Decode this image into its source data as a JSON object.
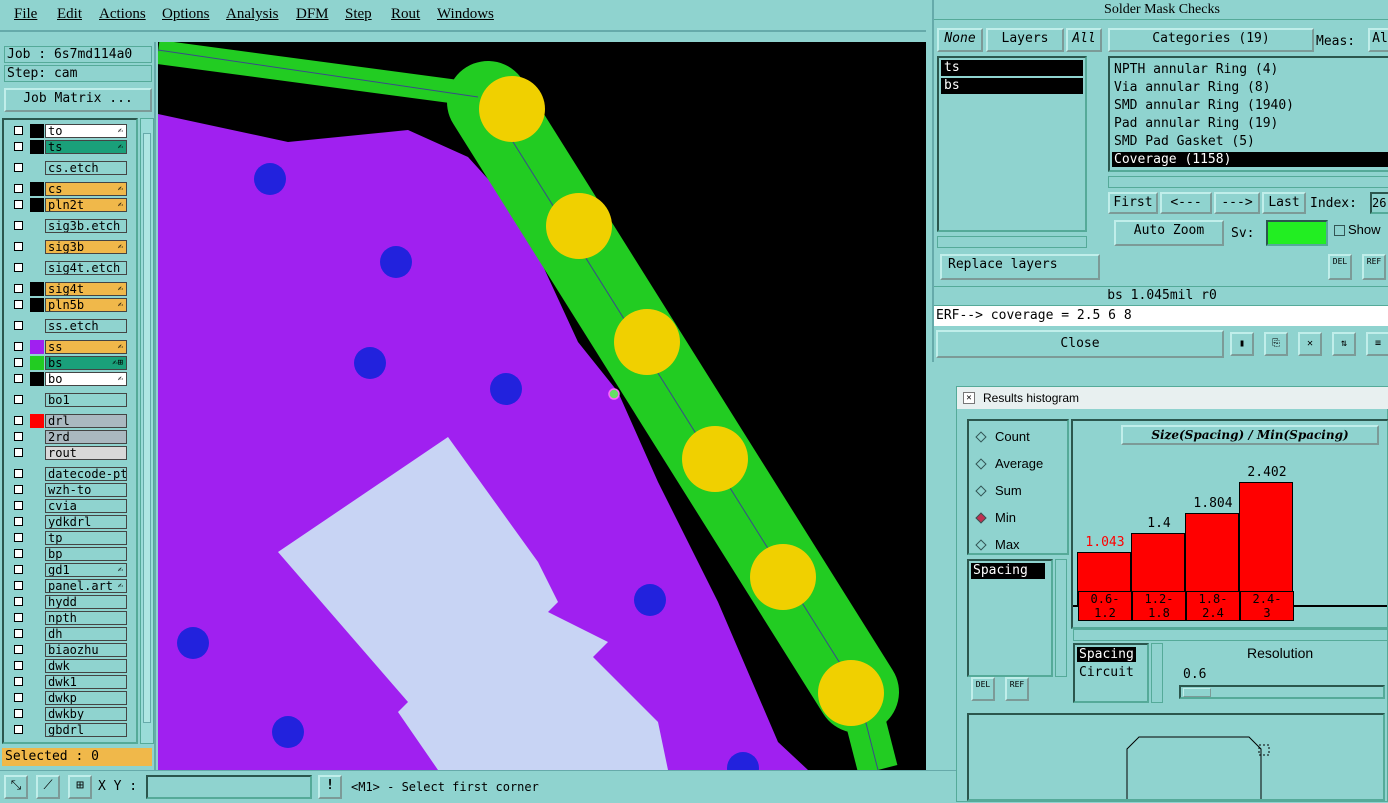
{
  "menu": [
    "File",
    "Edit",
    "Actions",
    "Options",
    "Analysis",
    "DFM",
    "Step",
    "Rout",
    "Windows"
  ],
  "job": {
    "job_label": "Job : 6s7md114a0",
    "step_label": "Step: cam",
    "job_matrix_button": "Job Matrix ..."
  },
  "layers": [
    {
      "name": "to",
      "color": "#ffffff",
      "swatch": "#000000",
      "flag": "✍"
    },
    {
      "name": "ts",
      "color": "#1aa07a",
      "swatch": "#000000",
      "flag": "✍"
    },
    {
      "name": "cs.etch",
      "color": "#8fd3cf",
      "swatch": "",
      "flag": ""
    },
    {
      "name": "cs",
      "color": "#f0b84a",
      "swatch": "#000000",
      "flag": "✍"
    },
    {
      "name": "pln2t",
      "color": "#f0b84a",
      "swatch": "#000000",
      "flag": "✍"
    },
    {
      "name": "sig3b.etch",
      "color": "#8fd3cf",
      "swatch": "",
      "flag": ""
    },
    {
      "name": "sig3b",
      "color": "#f0b84a",
      "swatch": "",
      "flag": "✍"
    },
    {
      "name": "sig4t.etch",
      "color": "#8fd3cf",
      "swatch": "",
      "flag": ""
    },
    {
      "name": "sig4t",
      "color": "#f0b84a",
      "swatch": "#000000",
      "flag": "✍"
    },
    {
      "name": "pln5b",
      "color": "#f0b84a",
      "swatch": "#000000",
      "flag": "✍"
    },
    {
      "name": "ss.etch",
      "color": "#8fd3cf",
      "swatch": "",
      "flag": ""
    },
    {
      "name": "ss",
      "color": "#f0b84a",
      "swatch": "#a020f0",
      "flag": "✍"
    },
    {
      "name": "bs",
      "color": "#1aa07a",
      "swatch": "#22cc22",
      "flag": "✍⊞"
    },
    {
      "name": "bo",
      "color": "#ffffff",
      "swatch": "#000000",
      "flag": "✍"
    },
    {
      "name": "bo1",
      "color": "#8fd3cf",
      "swatch": "",
      "flag": ""
    },
    {
      "name": "drl",
      "color": "#aab8c0",
      "swatch": "#ff0000",
      "flag": ""
    },
    {
      "name": "2rd",
      "color": "#aab8c0",
      "swatch": "",
      "flag": ""
    },
    {
      "name": "rout",
      "color": "#d8d8d8",
      "swatch": "",
      "flag": ""
    },
    {
      "name": "datecode-ptc",
      "color": "#8fd3cf",
      "swatch": "",
      "flag": ""
    },
    {
      "name": "wzh-to",
      "color": "#8fd3cf",
      "swatch": "",
      "flag": ""
    },
    {
      "name": "cvia",
      "color": "#8fd3cf",
      "swatch": "",
      "flag": ""
    },
    {
      "name": "ydkdrl",
      "color": "#8fd3cf",
      "swatch": "",
      "flag": ""
    },
    {
      "name": "tp",
      "color": "#8fd3cf",
      "swatch": "",
      "flag": ""
    },
    {
      "name": "bp",
      "color": "#8fd3cf",
      "swatch": "",
      "flag": ""
    },
    {
      "name": "gd1",
      "color": "#8fd3cf",
      "swatch": "",
      "flag": "✍"
    },
    {
      "name": "panel.art",
      "color": "#8fd3cf",
      "swatch": "",
      "flag": "✍"
    },
    {
      "name": "hydd",
      "color": "#8fd3cf",
      "swatch": "",
      "flag": ""
    },
    {
      "name": "npth",
      "color": "#8fd3cf",
      "swatch": "",
      "flag": ""
    },
    {
      "name": "dh",
      "color": "#8fd3cf",
      "swatch": "",
      "flag": ""
    },
    {
      "name": "biaozhu",
      "color": "#8fd3cf",
      "swatch": "",
      "flag": ""
    },
    {
      "name": "dwk",
      "color": "#8fd3cf",
      "swatch": "",
      "flag": ""
    },
    {
      "name": "dwk1",
      "color": "#8fd3cf",
      "swatch": "",
      "flag": ""
    },
    {
      "name": "dwkp",
      "color": "#8fd3cf",
      "swatch": "",
      "flag": ""
    },
    {
      "name": "dwkby",
      "color": "#8fd3cf",
      "swatch": "",
      "flag": ""
    },
    {
      "name": "gbdrl",
      "color": "#8fd3cf",
      "swatch": "",
      "flag": ""
    }
  ],
  "selected_label": "Selected : 0",
  "status": {
    "xy_label": "X Y :",
    "xy_value": "",
    "message": "<M1> - Select first corner"
  },
  "smc": {
    "title": "Solder Mask Checks",
    "none_btn": "None",
    "layers_btn": "Layers",
    "all_btn": "All",
    "layer_list": [
      "ts",
      "bs"
    ],
    "categories_btn": "Categories (19)",
    "meas_label": "Meas:",
    "meas_value": "Al",
    "categories": [
      "NPTH annular Ring (4)",
      "Via annular Ring (8)",
      "SMD annular Ring (1940)",
      "Pad annular Ring (19)",
      "SMD Pad Gasket (5)",
      "Coverage (1158)"
    ],
    "selected_category": "Coverage (1158)",
    "first_btn": "First",
    "prev_btn": "<---",
    "next_btn": "--->",
    "last_btn": "Last",
    "index_label": "Index:",
    "index_value": "26",
    "auto_zoom_btn": "Auto Zoom",
    "sv_label": "Sv:",
    "show_label": "Show",
    "replace_btn": "Replace layers",
    "del": "DEL",
    "ref": "REF",
    "info": "bs 1.045mil  r0",
    "erf": "ERF--> coverage = 2.5 6 8",
    "close_btn": "Close"
  },
  "hist": {
    "title": "Results histogram",
    "modes": [
      "Count",
      "Average",
      "Sum",
      "Min",
      "Max"
    ],
    "selected_mode": "Min",
    "chart_title": "Size(Spacing) / Min(Spacing)",
    "metric_list": [
      "Spacing"
    ],
    "spacing_item": "Spacing",
    "circuit_item": "Circuit",
    "resolution_label": "Resolution",
    "resolution_value": "0.6",
    "del": "DEL",
    "ref": "REF"
  },
  "chart_data": {
    "type": "bar",
    "title": "Size(Spacing) / Min(Spacing)",
    "categories": [
      "0.6-\n1.2",
      "1.2-\n1.8",
      "1.8-\n2.4",
      "2.4-\n3"
    ],
    "values": [
      1.043,
      1.4,
      1.804,
      2.402
    ],
    "value_labels": [
      "1.043",
      "1.4",
      "1.804",
      "2.402"
    ],
    "highlight_color": "#ff0000",
    "bar_color": "#ff0000"
  }
}
